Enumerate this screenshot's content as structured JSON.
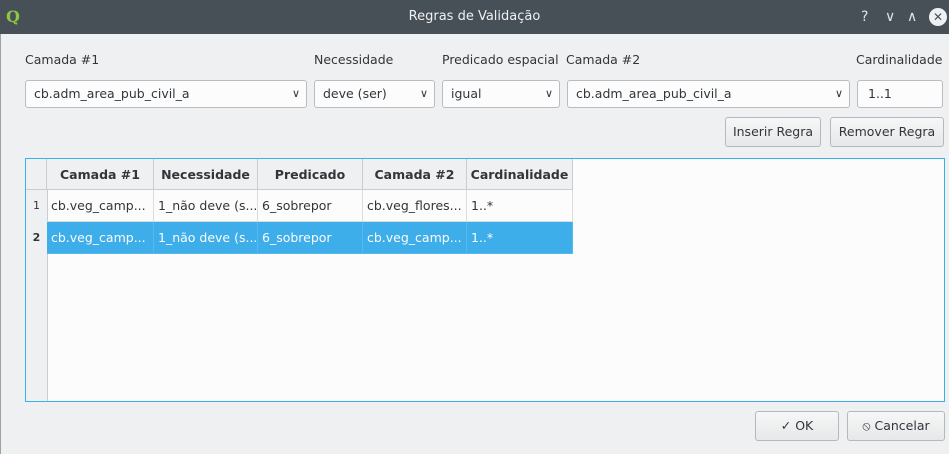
{
  "window": {
    "title": "Regras de Validação",
    "controls": {
      "help": "?",
      "minimize": "∨",
      "maximize": "∧",
      "close": "✕"
    },
    "logo": "Q"
  },
  "form": {
    "layer1_label": "Camada #1",
    "necessity_label": "Necessidade",
    "predicate_label": "Predicado espacial",
    "layer2_label": "Camada #2",
    "cardinality_label": "Cardinalidade",
    "layer1_value": "cb.adm_area_pub_civil_a",
    "necessity_value": "deve (ser)",
    "predicate_value": "igual",
    "layer2_value": "cb.adm_area_pub_civil_a",
    "cardinality_value": "1..1",
    "dropdown_arrow": "∨"
  },
  "buttons": {
    "insert_rule": "Inserir Regra",
    "remove_rule": "Remover Regra",
    "ok": "OK",
    "ok_icon": "✓",
    "cancel": "Cancelar",
    "cancel_icon": "⦸"
  },
  "table": {
    "headers": [
      "Camada #1",
      "Necessidade",
      "Predicado",
      "Camada #2",
      "Cardinalidade"
    ],
    "rows": [
      {
        "num": "1",
        "cells": [
          "cb.veg_camp...",
          "1_não deve (s...",
          "6_sobrepor",
          "cb.veg_flores...",
          "1..*"
        ]
      },
      {
        "num": "2",
        "cells": [
          "cb.veg_camp...",
          "1_não deve (s...",
          "6_sobrepor",
          "cb.veg_camp...",
          "1..*"
        ]
      }
    ],
    "selected_row": 2
  },
  "colors": {
    "titlebar": "#475057",
    "selection": "#3daee9",
    "background": "#eff0f1"
  }
}
